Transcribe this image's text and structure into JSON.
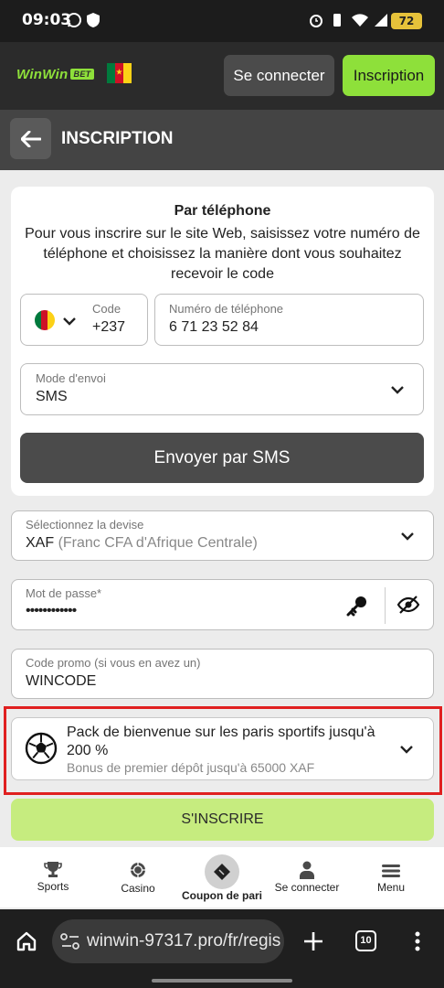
{
  "status_bar": {
    "time": "09:03",
    "battery": "72"
  },
  "header": {
    "logo_text": "WinWin",
    "logo_badge": "BET",
    "connect_label": "Se connecter",
    "register_label": "Inscription",
    "flag_colors": [
      "#007a3d",
      "#ce1126",
      "#fcd116"
    ]
  },
  "page": {
    "title": "INSCRIPTION"
  },
  "phone_card": {
    "title": "Par téléphone",
    "description": "Pour vous inscrire sur le site Web, saisissez votre numéro de téléphone et choisissez la manière dont vous souhaitez recevoir le code",
    "code_label": "Code",
    "code_value": "+237",
    "phone_label": "Numéro de téléphone",
    "phone_value": "6 71 23 52 84",
    "mode_label": "Mode d'envoi",
    "mode_value": "SMS",
    "send_button": "Envoyer par SMS"
  },
  "currency": {
    "label": "Sélectionnez la devise",
    "code": "XAF",
    "name": "(Franc CFA d'Afrique Centrale)"
  },
  "password": {
    "label": "Mot de passe*",
    "value": "••••••••••••"
  },
  "promo": {
    "label": "Code promo (si vous en avez un)",
    "value": "WINCODE"
  },
  "bonus": {
    "title": "Pack de bienvenue sur les paris sportifs jusqu'à 200 %",
    "subtitle": "Bonus de premier dépôt jusqu'à 65000 XAF"
  },
  "submit_label": "S'INSCRIRE",
  "tabs": [
    {
      "label": "Sports",
      "icon": "trophy-icon"
    },
    {
      "label": "Casino",
      "icon": "chip-icon"
    },
    {
      "label": "Coupon de pari",
      "icon": "ticket-icon"
    },
    {
      "label": "Se connecter",
      "icon": "user-icon"
    },
    {
      "label": "Menu",
      "icon": "menu-icon"
    }
  ],
  "browser": {
    "url": "winwin-97317.pro/fr/regis",
    "tab_count": "10"
  },
  "colors": {
    "accent": "#8ee03a",
    "highlight": "#e02020"
  }
}
